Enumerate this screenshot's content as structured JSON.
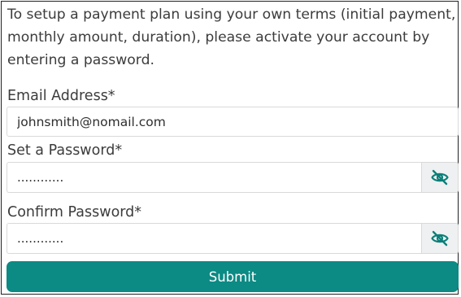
{
  "form": {
    "intro_text": "To setup a payment plan using your own terms (initial payment, monthly amount, duration), please activate your account by entering a password.",
    "email": {
      "label": "Email Address*",
      "value": "johnsmith@nomail.com"
    },
    "password": {
      "label": "Set a Password*",
      "value": "............",
      "toggle_icon": "eye-slash-icon"
    },
    "confirm_password": {
      "label": "Confirm Password*",
      "value": "............",
      "toggle_icon": "eye-slash-icon"
    },
    "submit_label": "Submit"
  },
  "colors": {
    "accent": "#0c8a84",
    "icon": "#0c7f79",
    "text": "#3c3c3c",
    "toggle_background": "#eef0f1"
  }
}
